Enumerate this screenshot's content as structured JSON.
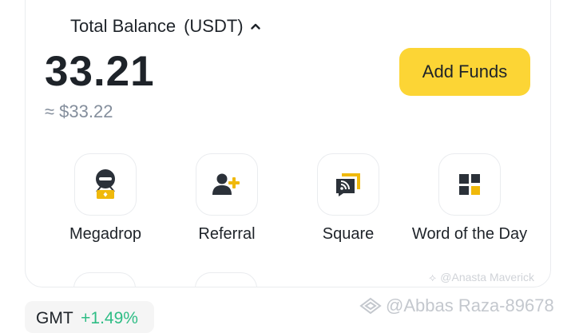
{
  "balance": {
    "label": "Total Balance",
    "currency": "(USDT)",
    "amount": "33.21",
    "approx": "≈ $33.22"
  },
  "add_funds_label": "Add Funds",
  "shortcuts": [
    {
      "label": "Megadrop",
      "icon": "megadrop-icon"
    },
    {
      "label": "Referral",
      "icon": "add-user-icon"
    },
    {
      "label": "Square",
      "icon": "square-feed-icon"
    },
    {
      "label": "Word of the Day",
      "icon": "grid-icon"
    }
  ],
  "ticker": {
    "symbol": "GMT",
    "change": "+1.49%"
  },
  "watermarks": {
    "small": "@Anasta Maverick",
    "large": "@Abbas Raza-89678"
  },
  "colors": {
    "accent": "#fcd535",
    "text": "#1e2329",
    "muted": "#848e9c",
    "positive": "#2ebd85",
    "icon_dark": "#2b3139",
    "icon_yellow": "#f0b90b"
  }
}
